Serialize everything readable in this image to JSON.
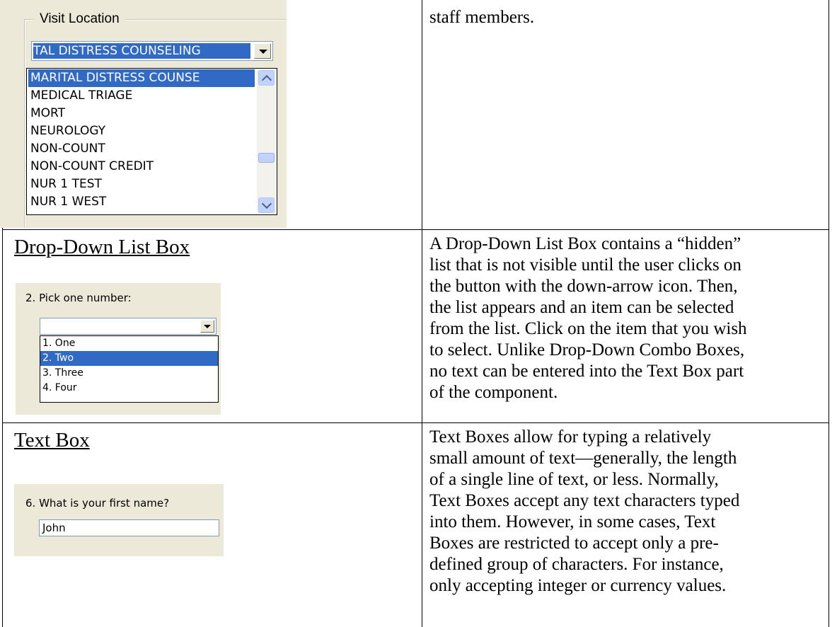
{
  "row1": {
    "group_label": "Visit Location",
    "combo_value": "TAL DISTRESS COUNSELING",
    "list_items": [
      "MARITAL DISTRESS COUNSE",
      "MEDICAL TRIAGE",
      "MORT",
      "NEUROLOGY",
      "NON-COUNT",
      "NON-COUNT CREDIT",
      "NUR 1 TEST",
      "NUR 1 WEST"
    ],
    "description_line": "staff members."
  },
  "row2": {
    "term": "Drop-Down List Box",
    "question": "2. Pick one number:",
    "combo_value": "",
    "list_items": [
      "1. One",
      "2. Two",
      "3. Three",
      "4. Four"
    ],
    "description": [
      "A Drop-Down List Box contains a “hidden”",
      "list that is not visible until the user clicks on",
      "the button with the down-arrow icon. Then,",
      "the list appears and an item can be selected",
      "from the list. Click on the item that you wish",
      "to select. Unlike Drop-Down Combo Boxes,",
      "no text can be entered into the Text Box part",
      "of the component."
    ]
  },
  "row3": {
    "term": "Text Box",
    "question": "6. What is your first name?",
    "textbox_value": "John",
    "description": [
      "Text Boxes allow for typing a relatively",
      "small amount of text—generally, the length",
      "of a single line of text, or less. Normally,",
      "Text Boxes accept any text characters typed",
      "into them. However, in some cases, Text",
      "Boxes are restricted to accept only a pre-",
      "defined group of characters. For instance,",
      "only accepting integer or currency values."
    ]
  },
  "colors": {
    "selection": "#316ac5",
    "dialog": "#ece9d8",
    "border": "#000000"
  }
}
